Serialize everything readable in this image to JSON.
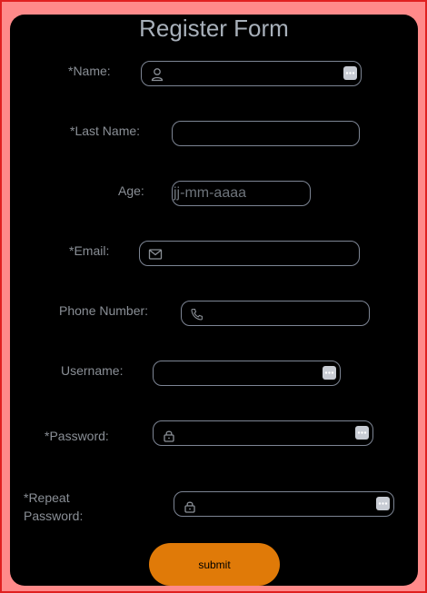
{
  "form": {
    "title": "Register Form",
    "fields": {
      "name": {
        "label": "*Name:",
        "value": ""
      },
      "last_name": {
        "label": "*Last Name:",
        "value": ""
      },
      "age": {
        "label": "Age:",
        "placeholder": "jj-mm-aaaa"
      },
      "email": {
        "label": "*Email:",
        "value": ""
      },
      "phone": {
        "label": "Phone Number:",
        "value": ""
      },
      "username": {
        "label": "Username:",
        "value": ""
      },
      "password": {
        "label": "*Password:",
        "value": ""
      },
      "repeat_password": {
        "label_line1": "*Repeat",
        "label_line2": "Password:",
        "value": ""
      }
    },
    "submit_label": "submit"
  },
  "icons": {
    "name": "user-icon",
    "email": "envelope-icon",
    "phone": "phone-icon",
    "password": "lock-icon",
    "password_manager": "more-dots-icon"
  },
  "colors": {
    "page_background": "#ff8a8a",
    "page_border": "#e02020",
    "card_background": "#000000",
    "submit_button": "#e07a08",
    "field_border": "#7d8594",
    "label_text": "#8a8f96"
  }
}
